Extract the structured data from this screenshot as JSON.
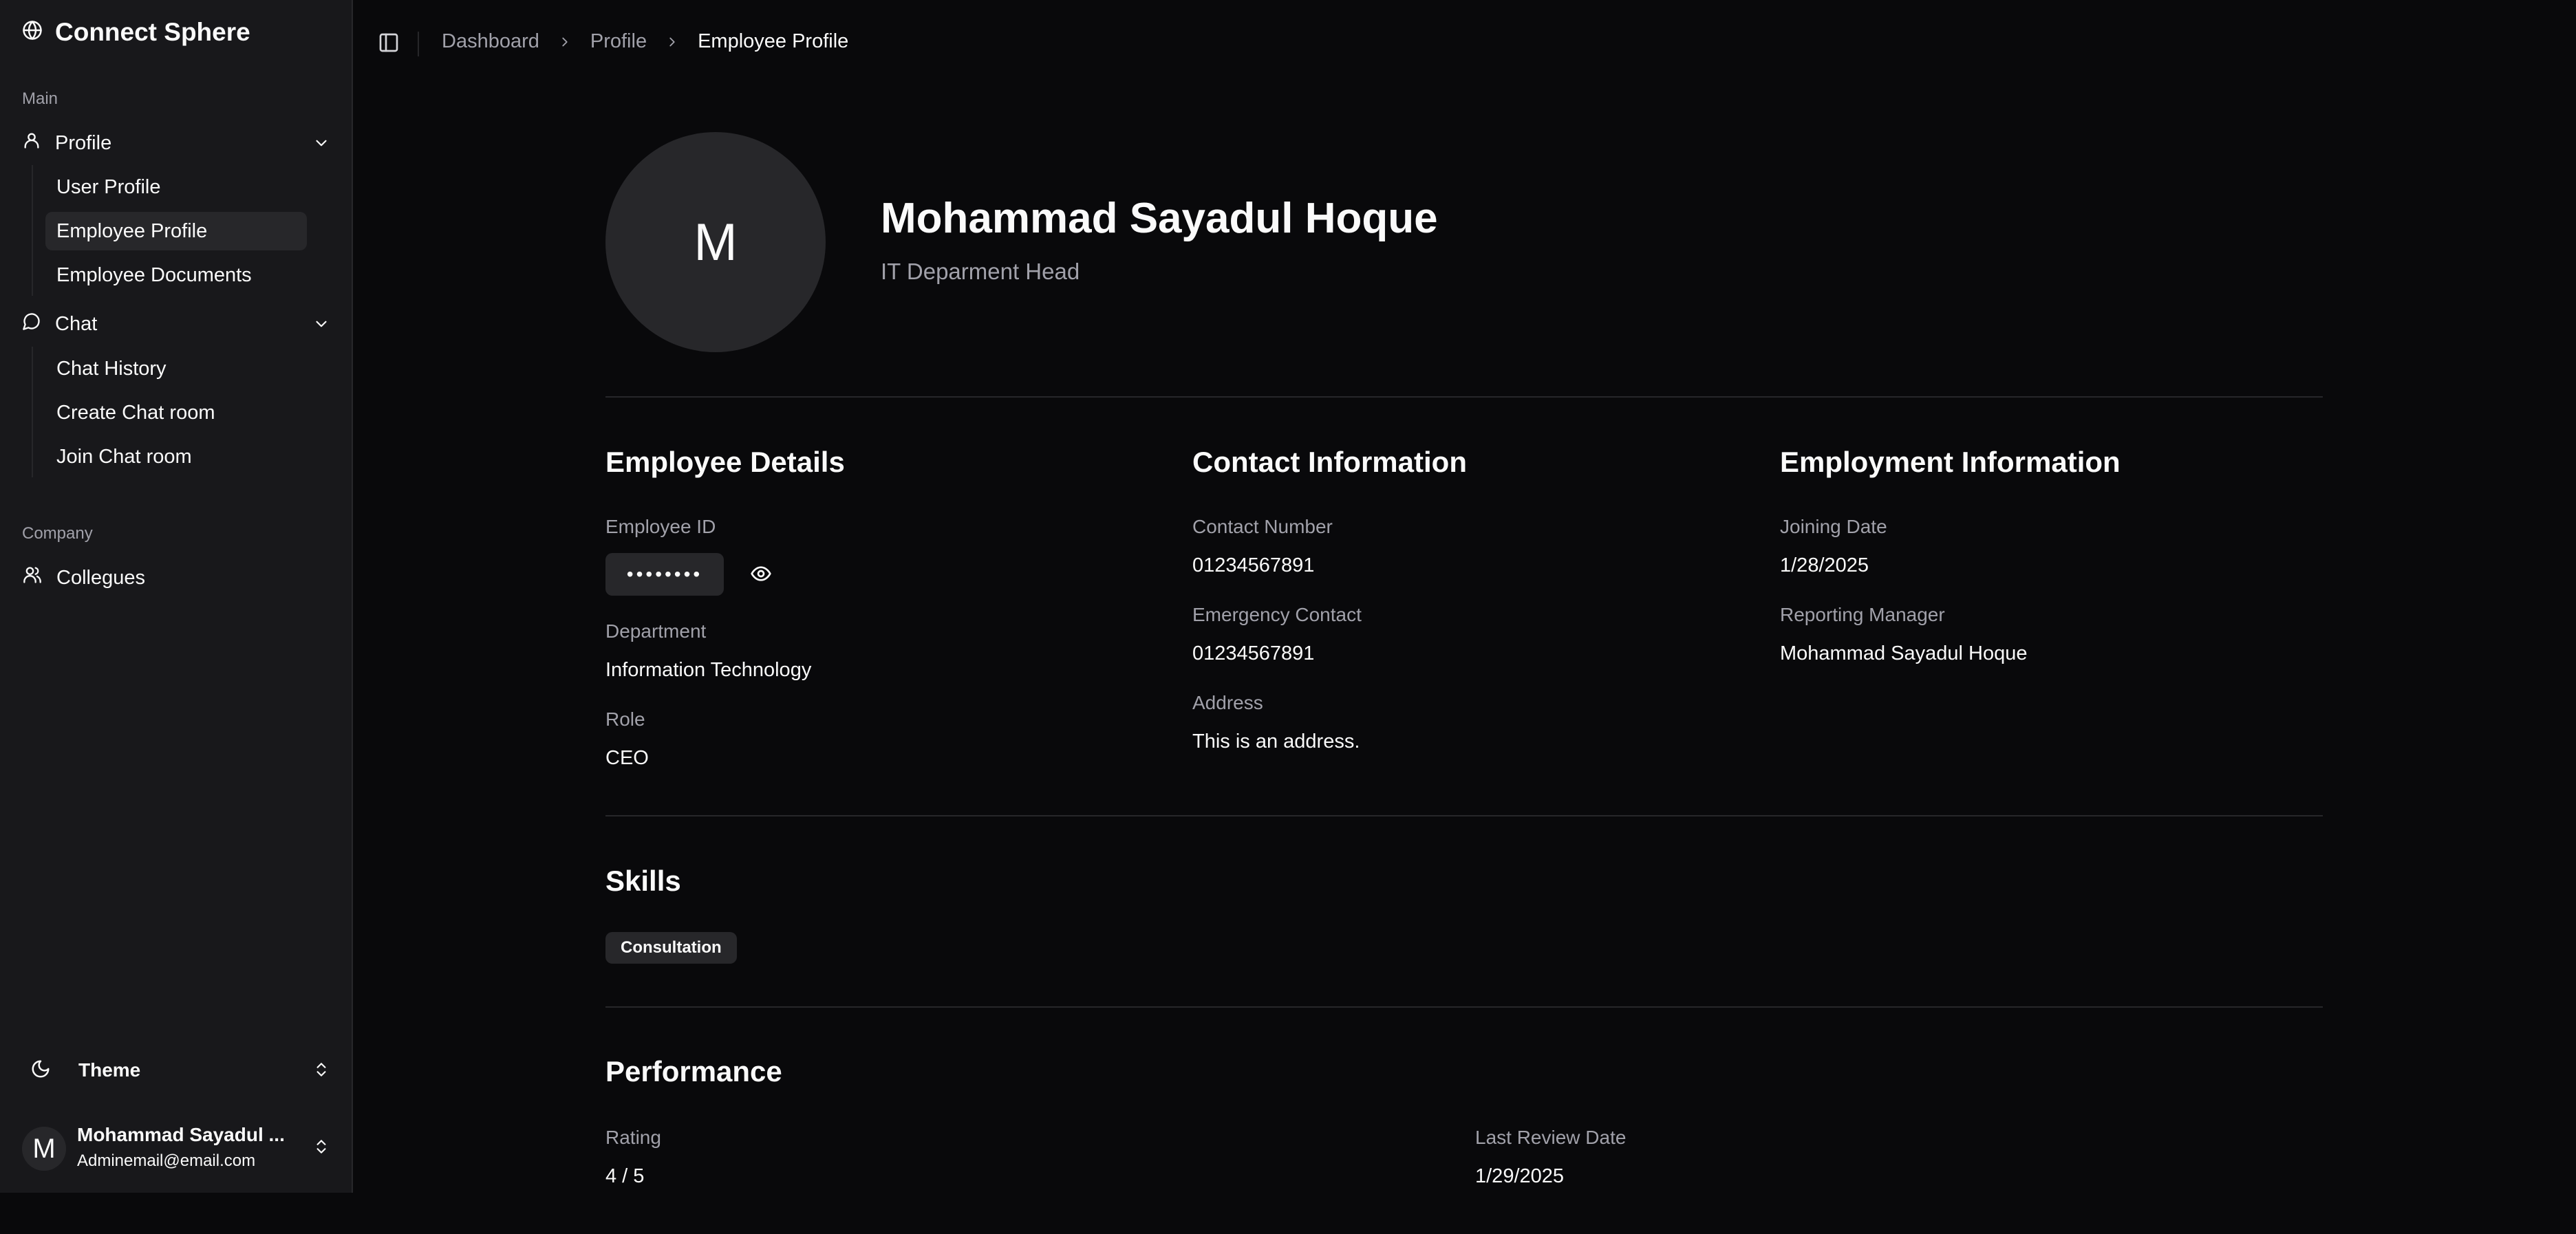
{
  "app": {
    "name": "Connect Sphere"
  },
  "sidebar": {
    "main_label": "Main",
    "profile": {
      "label": "Profile",
      "items": [
        {
          "label": "User Profile"
        },
        {
          "label": "Employee Profile",
          "active": true
        },
        {
          "label": "Employee Documents"
        }
      ]
    },
    "chat": {
      "label": "Chat",
      "items": [
        {
          "label": "Chat History"
        },
        {
          "label": "Create Chat room"
        },
        {
          "label": "Join Chat room"
        }
      ]
    },
    "company_label": "Company",
    "colleagues_label": "Collegues",
    "theme_label": "Theme",
    "user": {
      "initial": "M",
      "name": "Mohammad Sayadul ...",
      "email": "Adminemail@email.com"
    }
  },
  "breadcrumb": [
    "Dashboard",
    "Profile",
    "Employee Profile"
  ],
  "profile": {
    "initial": "M",
    "name": "Mohammad Sayadul Hoque",
    "title": "IT Deparment Head"
  },
  "employee_details": {
    "heading": "Employee Details",
    "id_label": "Employee ID",
    "id_masked": "••••••••",
    "department_label": "Department",
    "department": "Information Technology",
    "role_label": "Role",
    "role": "CEO"
  },
  "contact": {
    "heading": "Contact Information",
    "number_label": "Contact Number",
    "number": "01234567891",
    "emergency_label": "Emergency Contact",
    "emergency": "01234567891",
    "address_label": "Address",
    "address": "This is an address."
  },
  "employment": {
    "heading": "Employment Information",
    "joining_label": "Joining Date",
    "joining": "1/28/2025",
    "manager_label": "Reporting Manager",
    "manager": "Mohammad Sayadul Hoque"
  },
  "skills": {
    "heading": "Skills",
    "items": [
      "Consultation"
    ]
  },
  "performance": {
    "heading": "Performance",
    "rating_label": "Rating",
    "rating": "4 / 5",
    "review_label": "Last Review Date",
    "review": "1/29/2025"
  },
  "colors": {
    "background": "#09090b",
    "sidebar": "#18181b",
    "muted": "#a1a1aa",
    "surface": "#27272a",
    "foreground": "#fafafa"
  }
}
